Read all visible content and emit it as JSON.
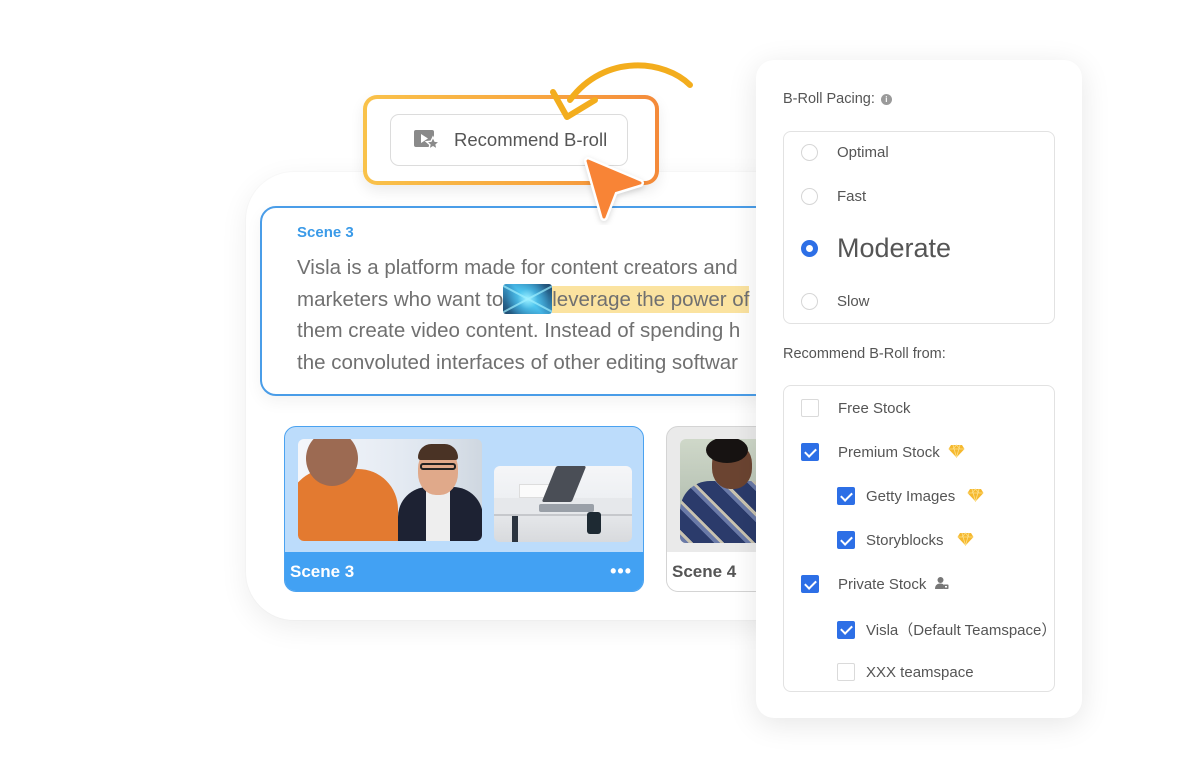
{
  "recommend_button": {
    "label": "Recommend B-roll",
    "icon": "video-star-icon"
  },
  "script": {
    "scene_label": "Scene 3",
    "lines": [
      {
        "before": "Visla is a platform made for content creators and",
        "highlight": "",
        "after": ""
      },
      {
        "before": "marketers who want to",
        "highlight": "leverage the power of",
        "after": ""
      },
      {
        "before": "them create video content. Instead of spending h",
        "highlight": "",
        "after": ""
      },
      {
        "before": "the convoluted interfaces of other editing softwar",
        "highlight": "",
        "after": ""
      }
    ],
    "inline_broll_thumb": "abstract-network-thumbnail"
  },
  "scenes": [
    {
      "title": "Scene 3",
      "active": true,
      "more_label": "•••"
    },
    {
      "title": "Scene 4",
      "active": false
    }
  ],
  "settings": {
    "pacing": {
      "title": "B-Roll Pacing:",
      "info_icon": "i",
      "options": [
        {
          "label": "Optimal",
          "selected": false
        },
        {
          "label": "Fast",
          "selected": false
        },
        {
          "label": "Moderate",
          "selected": true
        },
        {
          "label": "Slow",
          "selected": false
        }
      ]
    },
    "sources": {
      "title": "Recommend B-Roll from:",
      "options": [
        {
          "label": "Free Stock",
          "checked": false,
          "indent": 0,
          "badge": ""
        },
        {
          "label": "Premium Stock",
          "checked": true,
          "indent": 0,
          "badge": "gem-icon"
        },
        {
          "label": "Getty Images",
          "checked": true,
          "indent": 1,
          "badge": "gem-icon"
        },
        {
          "label": "Storyblocks",
          "checked": true,
          "indent": 1,
          "badge": "gem-icon"
        },
        {
          "label": "Private Stock",
          "checked": true,
          "indent": 0,
          "badge": "private-user-icon"
        },
        {
          "label": "Visla（Default Teamspace）",
          "checked": true,
          "indent": 1,
          "badge": ""
        },
        {
          "label": "XXX teamspace",
          "checked": false,
          "indent": 1,
          "badge": ""
        }
      ]
    }
  },
  "colors": {
    "accent_blue": "#2d6fe6",
    "scene_blue": "#42a1f3",
    "highlight_yellow": "#fbe3a0",
    "frame_orange": "#f48a3a",
    "frame_yellow": "#f9c24a",
    "gem_gold": "#f5b82e"
  }
}
